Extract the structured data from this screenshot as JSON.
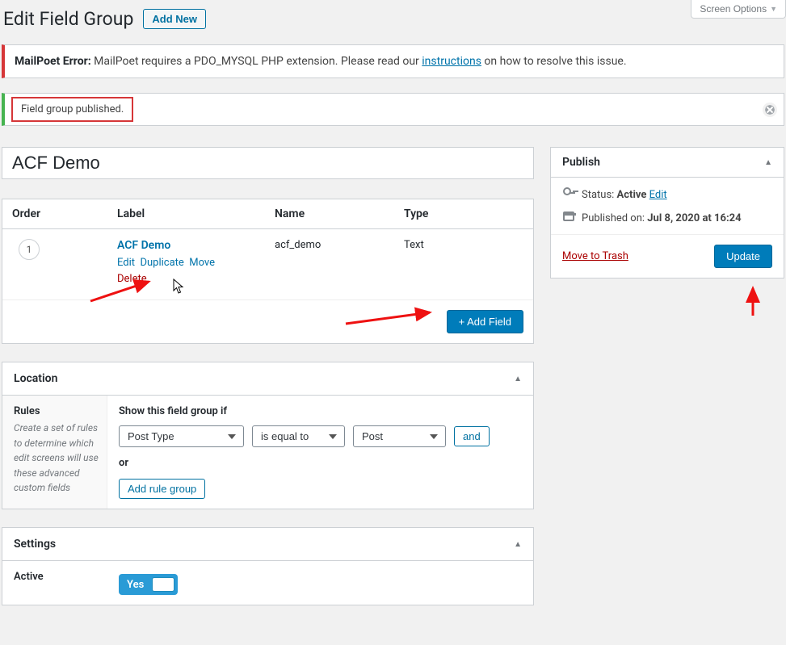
{
  "screen_options": {
    "label": "Screen Options"
  },
  "heading": {
    "title": "Edit Field Group",
    "add_new": "Add New"
  },
  "mp_notice": {
    "prefix": "MailPoet Error:",
    "body_a": " MailPoet requires a PDO_MYSQL PHP extension. Please read our ",
    "link": "instructions",
    "body_b": " on how to resolve this issue."
  },
  "published_notice": "Field group published.",
  "title_input": {
    "value": "ACF Demo"
  },
  "fields": {
    "head": {
      "order": "Order",
      "label": "Label",
      "name": "Name",
      "type": "Type"
    },
    "rows": [
      {
        "order": "1",
        "label": "ACF Demo",
        "name": "acf_demo",
        "type": "Text"
      }
    ],
    "actions": {
      "edit": "Edit",
      "duplicate": "Duplicate",
      "move": "Move",
      "delete": "Delete"
    },
    "add_field": "+ Add Field"
  },
  "location": {
    "title": "Location",
    "rules_label": "Rules",
    "rules_help": "Create a set of rules to determine which edit screens will use these advanced custom fields",
    "show_if": "Show this field group if",
    "param": "Post Type",
    "operator": "is equal to",
    "value": "Post",
    "and": "and",
    "or": "or",
    "add_rule_group": "Add rule group"
  },
  "settings": {
    "title": "Settings",
    "active_label": "Active",
    "toggle_value": "Yes"
  },
  "publish": {
    "title": "Publish",
    "status_label": "Status: ",
    "status_value": "Active",
    "edit": "Edit",
    "published_label": "Published on: ",
    "published_value": "Jul 8, 2020 at 16:24",
    "trash": "Move to Trash",
    "update": "Update"
  }
}
